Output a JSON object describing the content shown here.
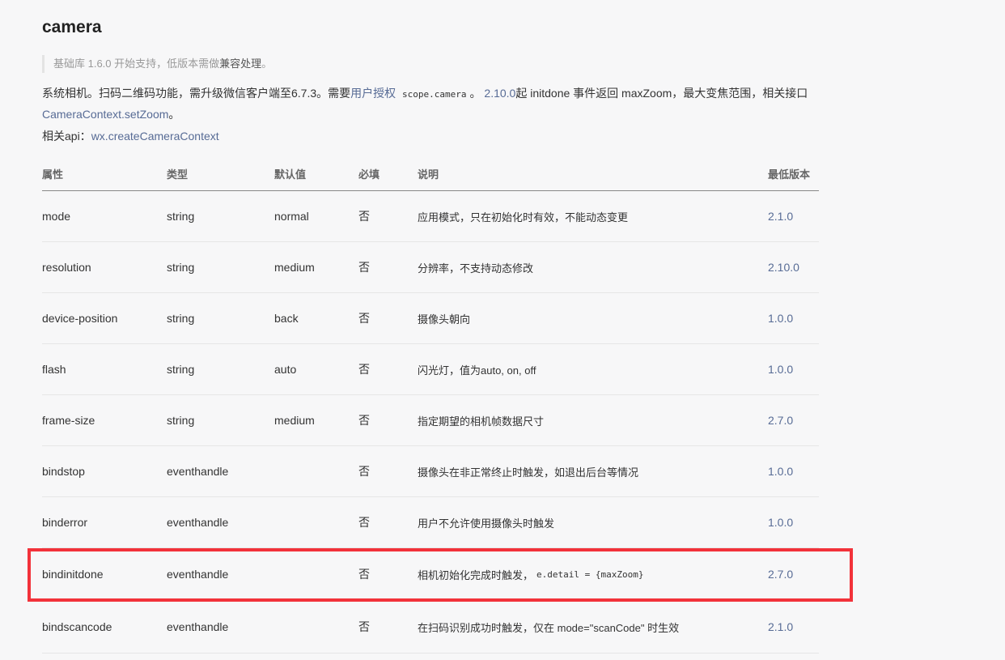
{
  "title": "camera",
  "note": {
    "prefix": "基础库 1.6.0 开始支持，低版本需做",
    "link": "兼容处理",
    "suffix": "。"
  },
  "description": {
    "t1": "系统相机。扫码二维码功能，需升级微信客户端至6.7.3。需要",
    "link_auth": "用户授权",
    "scope": "scope.camera",
    "t2": "。",
    "link_version": "2.10.0",
    "t3": "起 initdone 事件返回 maxZoom，最大变焦范围，相关接口",
    "link_setzoom": "CameraContext.setZoom",
    "t4": "。"
  },
  "api": {
    "label": "相关api：",
    "link": "wx.createCameraContext"
  },
  "table": {
    "headers": [
      "属性",
      "类型",
      "默认值",
      "必填",
      "说明",
      "最低版本"
    ],
    "rows": [
      {
        "name": "mode",
        "type": "string",
        "default": "normal",
        "required": "否",
        "desc": "应用模式，只在初始化时有效，不能动态变更",
        "code": "",
        "version": "2.1.0"
      },
      {
        "name": "resolution",
        "type": "string",
        "default": "medium",
        "required": "否",
        "desc": "分辨率，不支持动态修改",
        "code": "",
        "version": "2.10.0"
      },
      {
        "name": "device-position",
        "type": "string",
        "default": "back",
        "required": "否",
        "desc": "摄像头朝向",
        "code": "",
        "version": "1.0.0"
      },
      {
        "name": "flash",
        "type": "string",
        "default": "auto",
        "required": "否",
        "desc": "闪光灯，值为auto, on, off",
        "code": "",
        "version": "1.0.0"
      },
      {
        "name": "frame-size",
        "type": "string",
        "default": "medium",
        "required": "否",
        "desc": "指定期望的相机帧数据尺寸",
        "code": "",
        "version": "2.7.0"
      },
      {
        "name": "bindstop",
        "type": "eventhandle",
        "default": "",
        "required": "否",
        "desc": "摄像头在非正常终止时触发，如退出后台等情况",
        "code": "",
        "version": "1.0.0"
      },
      {
        "name": "binderror",
        "type": "eventhandle",
        "default": "",
        "required": "否",
        "desc": "用户不允许使用摄像头时触发",
        "code": "",
        "version": "1.0.0"
      },
      {
        "name": "bindinitdone",
        "type": "eventhandle",
        "default": "",
        "required": "否",
        "desc": "相机初始化完成时触发，",
        "code": "e.detail = {maxZoom}",
        "version": "2.7.0"
      },
      {
        "name": "bindscancode",
        "type": "eventhandle",
        "default": "",
        "required": "否",
        "desc": "在扫码识别成功时触发，仅在 mode=\"scanCode\" 时生效",
        "code": "",
        "version": "2.1.0"
      }
    ]
  },
  "colors": {
    "link": "#576b95",
    "highlight": "#f2323a",
    "background": "#f7f7f8"
  }
}
